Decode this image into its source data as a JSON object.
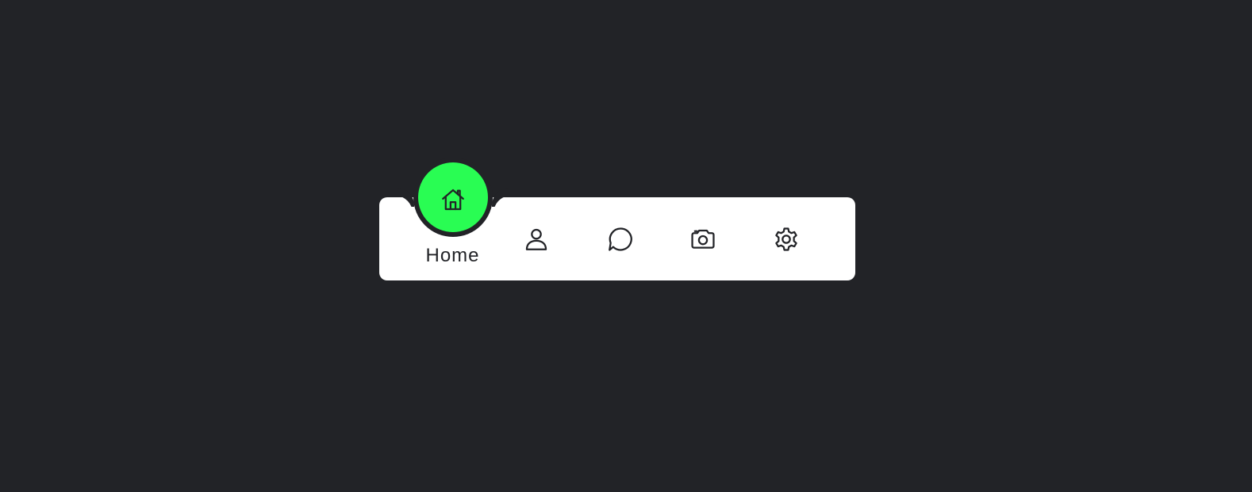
{
  "colors": {
    "background": "#222327",
    "bar": "#ffffff",
    "accent": "#29fd53",
    "icon": "#222327"
  },
  "nav": {
    "active_index": 0,
    "items": [
      {
        "label": "Home",
        "icon": "home-icon"
      },
      {
        "label": "",
        "icon": "person-icon"
      },
      {
        "label": "",
        "icon": "chat-icon"
      },
      {
        "label": "",
        "icon": "camera-icon"
      },
      {
        "label": "",
        "icon": "settings-icon"
      }
    ]
  }
}
